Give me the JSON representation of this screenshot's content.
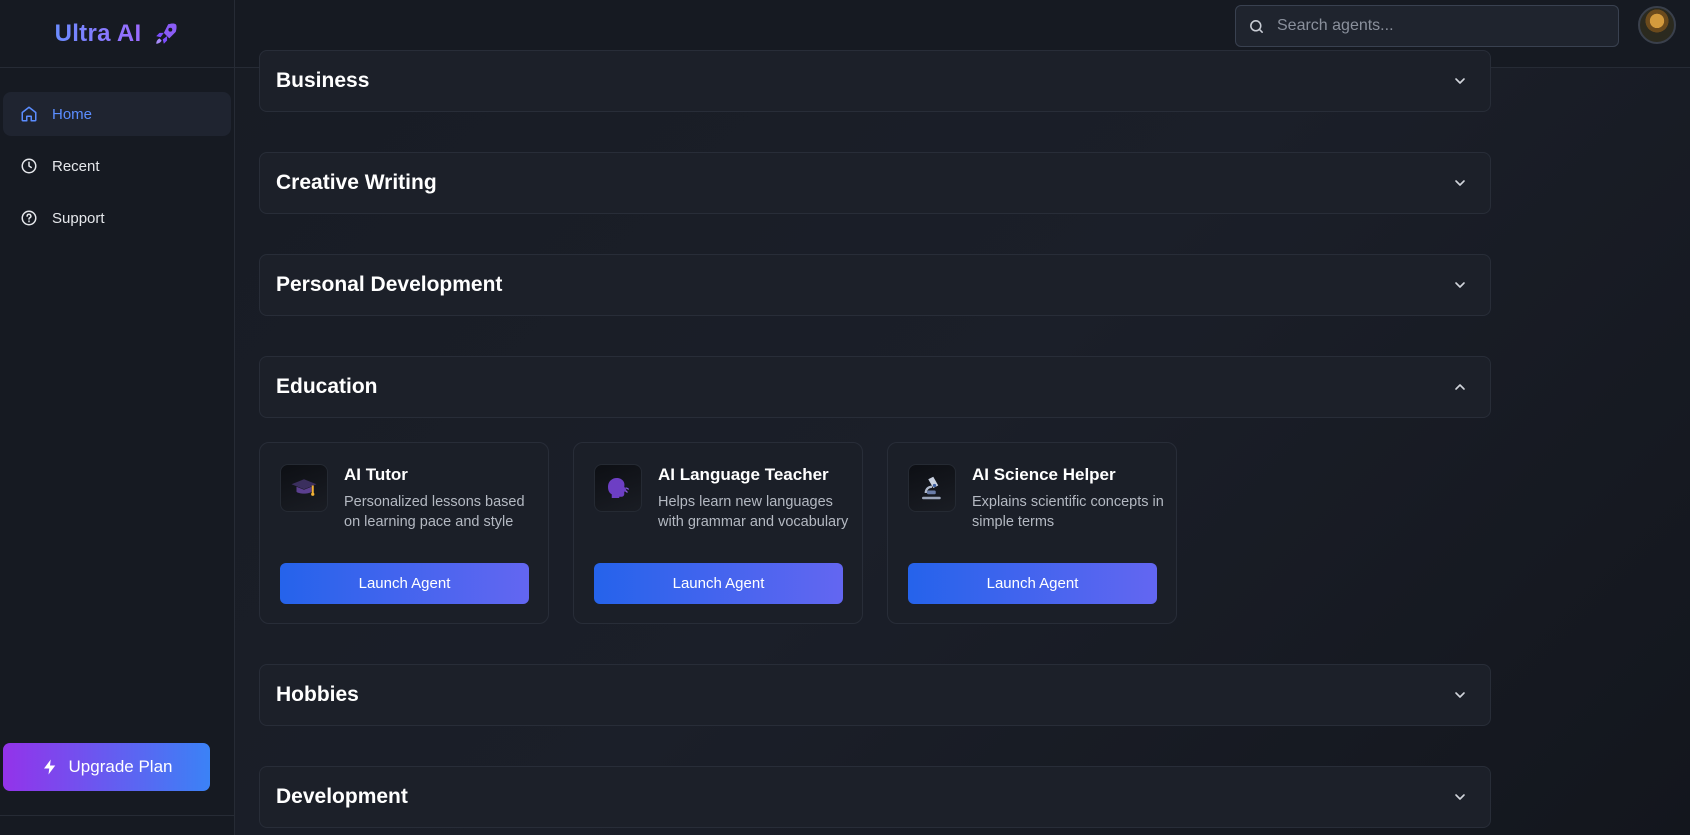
{
  "app": {
    "name": "Ultra AI",
    "logo_icon": "rocket-icon"
  },
  "sidebar": {
    "items": [
      {
        "label": "Home",
        "icon": "home-icon",
        "active": true
      },
      {
        "label": "Recent",
        "icon": "clock-icon",
        "active": false
      },
      {
        "label": "Support",
        "icon": "help-circle-icon",
        "active": false
      }
    ],
    "upgrade_label": "Upgrade Plan"
  },
  "header": {
    "search_placeholder": "Search agents..."
  },
  "categories": [
    {
      "title": "Business",
      "expanded": false
    },
    {
      "title": "Creative Writing",
      "expanded": false
    },
    {
      "title": "Personal Development",
      "expanded": false
    },
    {
      "title": "Education",
      "expanded": true
    },
    {
      "title": "Hobbies",
      "expanded": false
    },
    {
      "title": "Development",
      "expanded": false
    }
  ],
  "education_agents": [
    {
      "title": "AI Tutor",
      "description": "Personalized lessons based on learning pace and style",
      "icon": "graduation-cap-icon",
      "button": "Launch Agent"
    },
    {
      "title": "AI Language Teacher",
      "description": "Helps learn new languages with grammar and vocabulary",
      "icon": "speaking-head-icon",
      "button": "Launch Agent"
    },
    {
      "title": "AI Science Helper",
      "description": "Explains scientific concepts in simple terms",
      "icon": "microscope-icon",
      "button": "Launch Agent"
    }
  ],
  "colors": {
    "accent": "#5b8dff",
    "button_start": "#2563eb",
    "button_end": "#6366f1",
    "upgrade_start": "#9333ea",
    "upgrade_end": "#3b82f6"
  }
}
